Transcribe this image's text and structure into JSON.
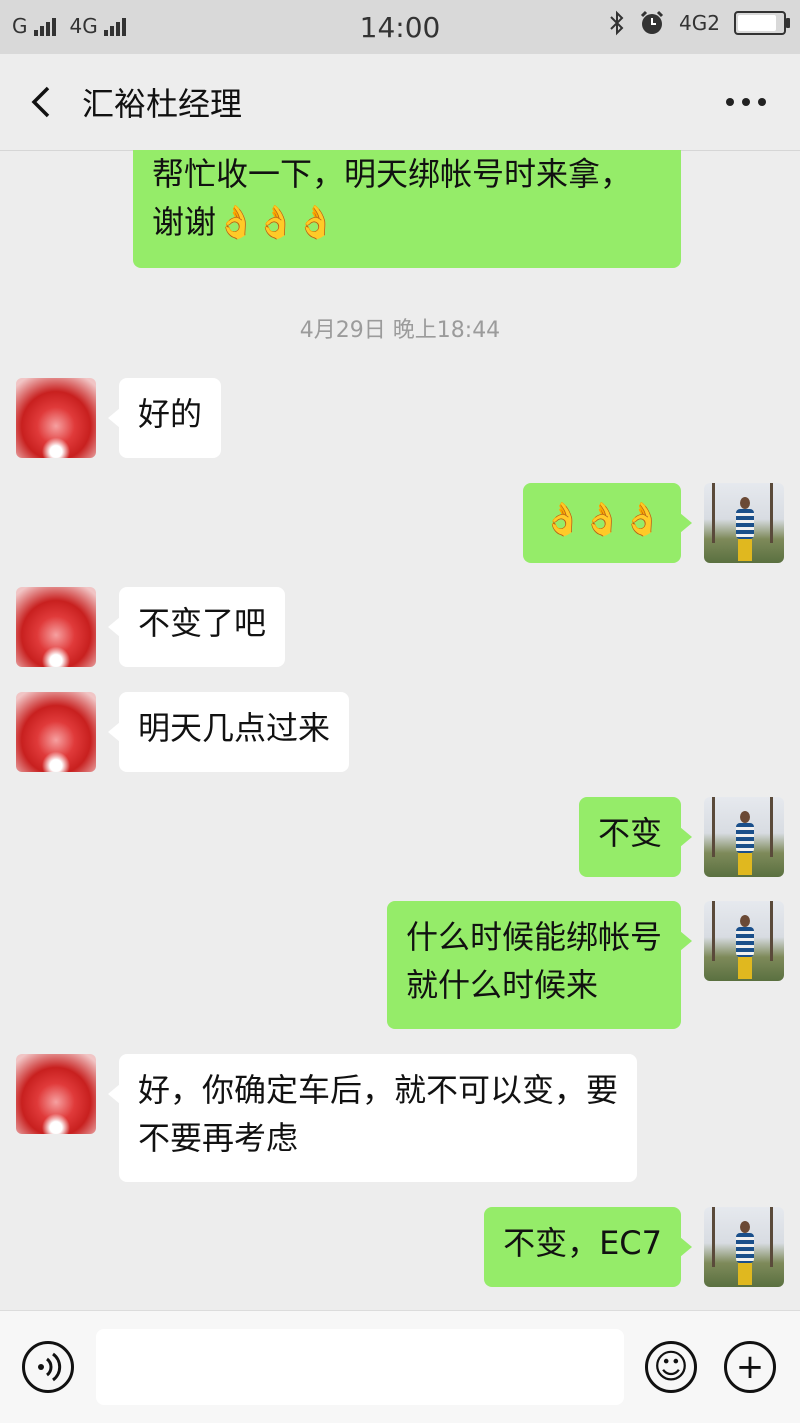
{
  "status_bar": {
    "carrier_1": "G",
    "carrier_2": "4G",
    "time": "14:00",
    "network_right": "4G2",
    "battery_level": 0.95
  },
  "header": {
    "title": "汇裕杜经理"
  },
  "chat": {
    "timestamp": "4月29日 晚上18:44",
    "messages": [
      {
        "side": "right",
        "text_line1": "帮忙收一下，明天绑帐号时来拿，",
        "text_line2": "谢谢👌👌👌"
      },
      {
        "side": "left",
        "text": "好的"
      },
      {
        "side": "right",
        "text": "👌👌👌"
      },
      {
        "side": "left",
        "text": "不变了吧"
      },
      {
        "side": "left",
        "text": "明天几点过来"
      },
      {
        "side": "right",
        "text": "不变"
      },
      {
        "side": "right",
        "text_line1": "什么时候能绑帐号",
        "text_line2": "就什么时候来"
      },
      {
        "side": "left",
        "text_line1": "好，你确定车后，就不可以变，要",
        "text_line2": "不要再考虑"
      },
      {
        "side": "right",
        "text": "不变，EC7"
      }
    ]
  },
  "input_bar": {
    "placeholder": "",
    "emoji_glyph": "☺",
    "plus_glyph": "+"
  },
  "colors": {
    "bubble_right": "#95ec69",
    "bubble_left": "#ffffff",
    "background": "#ededed"
  }
}
